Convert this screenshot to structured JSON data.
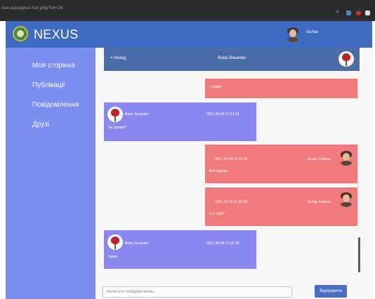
{
  "browser": {
    "url": "nexus/pages/chat.php?id=26"
  },
  "navbar": {
    "brand": "NEXUS",
    "user_name": "Аслан"
  },
  "sidebar": {
    "items": [
      {
        "label": "Моя сторінка"
      },
      {
        "label": "Публікації"
      },
      {
        "label": "Повідомлення"
      },
      {
        "label": "Друзі"
      }
    ]
  },
  "chat": {
    "back_label": "< Назад",
    "partner_name": "Вова Зіньвова",
    "messages": [
      {
        "sender": "me",
        "name": "",
        "time": "",
        "text": "згоден"
      },
      {
        "sender": "them",
        "name": "Вова Зіньвова",
        "time": "2021-06-04 21:31:13",
        "text": "Як справи?"
      },
      {
        "sender": "me",
        "name": "Аслан Сиваєв",
        "time": "2021-06-04 21:31:39",
        "text": "Все чудово."
      },
      {
        "sender": "me",
        "name": "Аслан Сиваєв",
        "time": "2021-06-04 21:31:50",
        "text": "А у тебе?"
      },
      {
        "sender": "them",
        "name": "Вова Зіньвова",
        "time": "2021-06-04 21:32:30",
        "text": "також"
      }
    ],
    "input_placeholder": "Написати повідомлення...",
    "send_label": "Відправити"
  },
  "colors": {
    "navbar": "#3d6bc2",
    "sidebar": "#7a8ff0",
    "my_message": "#f27a7d",
    "their_message": "#8a87f0",
    "chat_header": "#4a6da8"
  }
}
